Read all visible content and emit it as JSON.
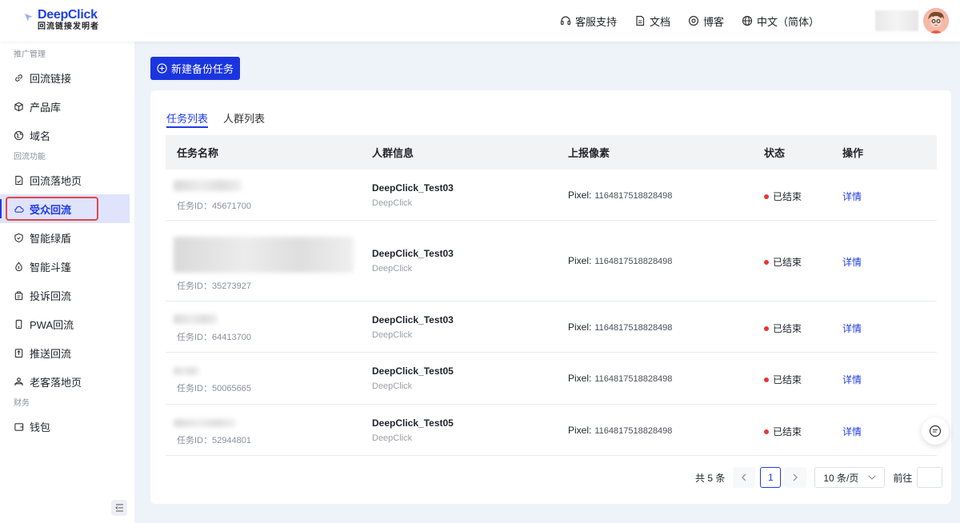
{
  "header": {
    "brand": "DeepClick",
    "brand_sub": "回流链接发明者",
    "nav": [
      {
        "label": "客服支持",
        "icon": "headset-icon"
      },
      {
        "label": "文档",
        "icon": "document-icon"
      },
      {
        "label": "博客",
        "icon": "blog-icon"
      },
      {
        "label": "中文（简体）",
        "icon": "globe-icon"
      }
    ]
  },
  "sidebar": {
    "groups": [
      {
        "title": "推广管理",
        "items": [
          {
            "label": "回流链接",
            "icon": "link-icon"
          },
          {
            "label": "产品库",
            "icon": "cube-icon"
          },
          {
            "label": "域名",
            "icon": "globe-icon"
          }
        ]
      },
      {
        "title": "回流功能",
        "items": [
          {
            "label": "回流落地页",
            "icon": "page-icon"
          },
          {
            "label": "受众回流",
            "icon": "cloud-icon",
            "active": true
          },
          {
            "label": "智能绿盾",
            "icon": "shield-icon"
          },
          {
            "label": "智能斗篷",
            "icon": "drop-icon"
          },
          {
            "label": "投诉回流",
            "icon": "complaint-icon"
          },
          {
            "label": "PWA回流",
            "icon": "phone-icon"
          },
          {
            "label": "推送回流",
            "icon": "push-icon"
          },
          {
            "label": "老客落地页",
            "icon": "users-icon"
          }
        ]
      },
      {
        "title": "财务",
        "items": [
          {
            "label": "钱包",
            "icon": "wallet-icon"
          }
        ]
      }
    ]
  },
  "toolbar": {
    "new_task_label": "新建备份任务"
  },
  "tabs": [
    {
      "label": "任务列表",
      "active": true
    },
    {
      "label": "人群列表",
      "active": false
    }
  ],
  "table": {
    "columns": [
      "任务名称",
      "人群信息",
      "上报像素",
      "状态",
      "操作"
    ],
    "rows": [
      {
        "task_id_label": "任务ID：",
        "task_id": "45671700",
        "crowd": "DeepClick_Test03",
        "crowd_sub": "DeepClick",
        "pixel_label": "Pixel:",
        "pixel": "1164817518828498",
        "status": "已结束",
        "action": "详情"
      },
      {
        "task_id_label": "任务ID：",
        "task_id": "35273927",
        "crowd": "DeepClick_Test03",
        "crowd_sub": "DeepClick",
        "pixel_label": "Pixel:",
        "pixel": "1164817518828498",
        "status": "已结束",
        "action": "详情"
      },
      {
        "task_id_label": "任务ID：",
        "task_id": "64413700",
        "crowd": "DeepClick_Test03",
        "crowd_sub": "DeepClick",
        "pixel_label": "Pixel:",
        "pixel": "1164817518828498",
        "status": "已结束",
        "action": "详情"
      },
      {
        "task_id_label": "任务ID：",
        "task_id": "50065665",
        "crowd": "DeepClick_Test05",
        "crowd_sub": "DeepClick",
        "pixel_label": "Pixel:",
        "pixel": "1164817518828498",
        "status": "已结束",
        "action": "详情"
      },
      {
        "task_id_label": "任务ID：",
        "task_id": "52944801",
        "crowd": "DeepClick_Test05",
        "crowd_sub": "DeepClick",
        "pixel_label": "Pixel:",
        "pixel": "1164817518828498",
        "status": "已结束",
        "action": "详情"
      }
    ]
  },
  "pagination": {
    "total": "共 5 条",
    "current_page": "1",
    "page_size": "10 条/页",
    "goto_label": "前往"
  },
  "colors": {
    "accent": "#1e3be6",
    "status_ended": "#e53935",
    "highlight_box": "#e2464a"
  }
}
